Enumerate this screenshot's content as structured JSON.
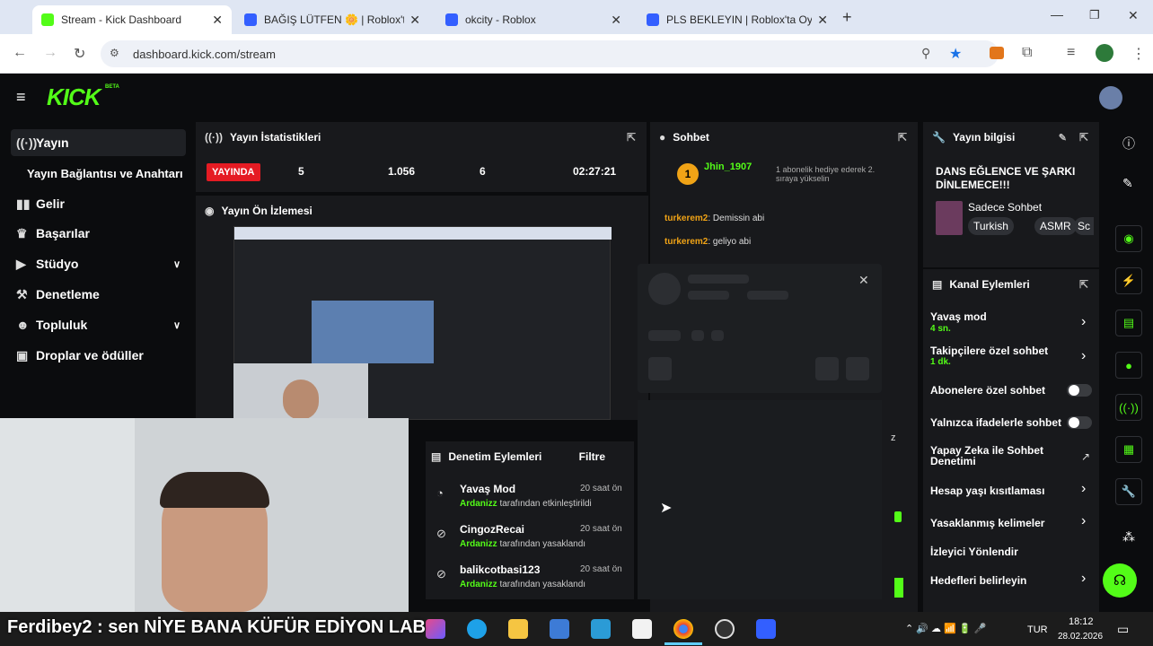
{
  "browser": {
    "tabs": [
      {
        "title": "Stream - Kick Dashboard",
        "active": true
      },
      {
        "title": "BAĞIŞ LÜTFEN 🌼 | Roblox'ta Oyna",
        "active": false
      },
      {
        "title": "okcity - Roblox",
        "active": false
      },
      {
        "title": "PLS BEKLEYIN | Roblox'ta Oyna",
        "active": false
      }
    ],
    "url": "dashboard.kick.com/stream"
  },
  "brand": {
    "logo": "KICK",
    "beta": "BETA",
    "accent": "#53fc18"
  },
  "sidebar": {
    "items": [
      {
        "label": "Yayın",
        "icon": "broadcast-icon"
      },
      {
        "label": "Yayın Bağlantısı ve Anahtarı",
        "icon": ""
      },
      {
        "label": "Gelir",
        "icon": "bar-chart-icon"
      },
      {
        "label": "Başarılar",
        "icon": "trophy-icon"
      },
      {
        "label": "Stüdyo",
        "icon": "video-icon"
      },
      {
        "label": "Denetleme",
        "icon": "gavel-icon"
      },
      {
        "label": "Topluluk",
        "icon": "people-icon"
      },
      {
        "label": "Droplar ve ödüller",
        "icon": "gift-icon"
      }
    ]
  },
  "stats": {
    "title": "Yayın İstatistikleri",
    "live_badge": "YAYINDA",
    "viewers": "5",
    "followers": "1.056",
    "subs": "6",
    "duration": "02:27:21"
  },
  "preview": {
    "title": "Yayın Ön İzlemesi"
  },
  "chat": {
    "title": "Sohbet",
    "pinned": {
      "user": "Jhin_1907",
      "badge": "1",
      "text": "1 abonelik hediye ederek 2. sıraya yükselin"
    },
    "messages": [
      {
        "user": "turkerem2",
        "text": "Demissin abi"
      },
      {
        "user": "turkerem2",
        "text": "geliyo abi"
      }
    ],
    "overflow_text": "z"
  },
  "moderation": {
    "title": "Denetim Eylemleri",
    "filter": "Filtre",
    "items": [
      {
        "action": "Yavaş Mod",
        "by": "Ardanizz",
        "rest": "tarafından etkinleştirildi",
        "time": "20 saat ön"
      },
      {
        "action": "CingozRecai",
        "by": "Ardanizz",
        "rest": "tarafından yasaklandı",
        "time": "20 saat ön"
      },
      {
        "action": "balikcotbasi123",
        "by": "Ardanizz",
        "rest": "tarafından yasaklandı",
        "time": "20 saat ön"
      }
    ]
  },
  "stream_info": {
    "title": "Yayın bilgisi",
    "stream_title": "DANS EĞLENCE VE ŞARKI DİNLEMECE!!!",
    "category": "Sadece Sohbet",
    "tags": [
      "Turkish",
      "ASMR",
      "Sc"
    ]
  },
  "channel_actions": {
    "title": "Kanal Eylemleri",
    "items": [
      {
        "label": "Yavaş mod",
        "sub": "4 sn.",
        "control": "chevron"
      },
      {
        "label": "Takipçilere özel sohbet",
        "sub": "1 dk.",
        "control": "chevron"
      },
      {
        "label": "Abonelere özel sohbet",
        "sub": "",
        "control": "toggle"
      },
      {
        "label": "Yalnızca ifadelerle sohbet",
        "sub": "",
        "control": "toggle"
      },
      {
        "label": "Yapay Zeka ile Sohbet Denetimi",
        "sub": "",
        "control": "external"
      },
      {
        "label": "Hesap yaşı kısıtlaması",
        "sub": "",
        "control": "chevron"
      },
      {
        "label": "Yasaklanmış kelimeler",
        "sub": "",
        "control": "chevron"
      },
      {
        "label": "İzleyici Yönlendir",
        "sub": "",
        "control": "none"
      },
      {
        "label": "Hedefleri belirleyin",
        "sub": "",
        "control": "chevron"
      }
    ]
  },
  "overlay_caption": "Ferdibey2 : sen NİYE BANA KÜFÜR EDİYON LAB",
  "taskbar": {
    "lang": "TUR",
    "time": "18:12",
    "date": "28.02.2026"
  }
}
